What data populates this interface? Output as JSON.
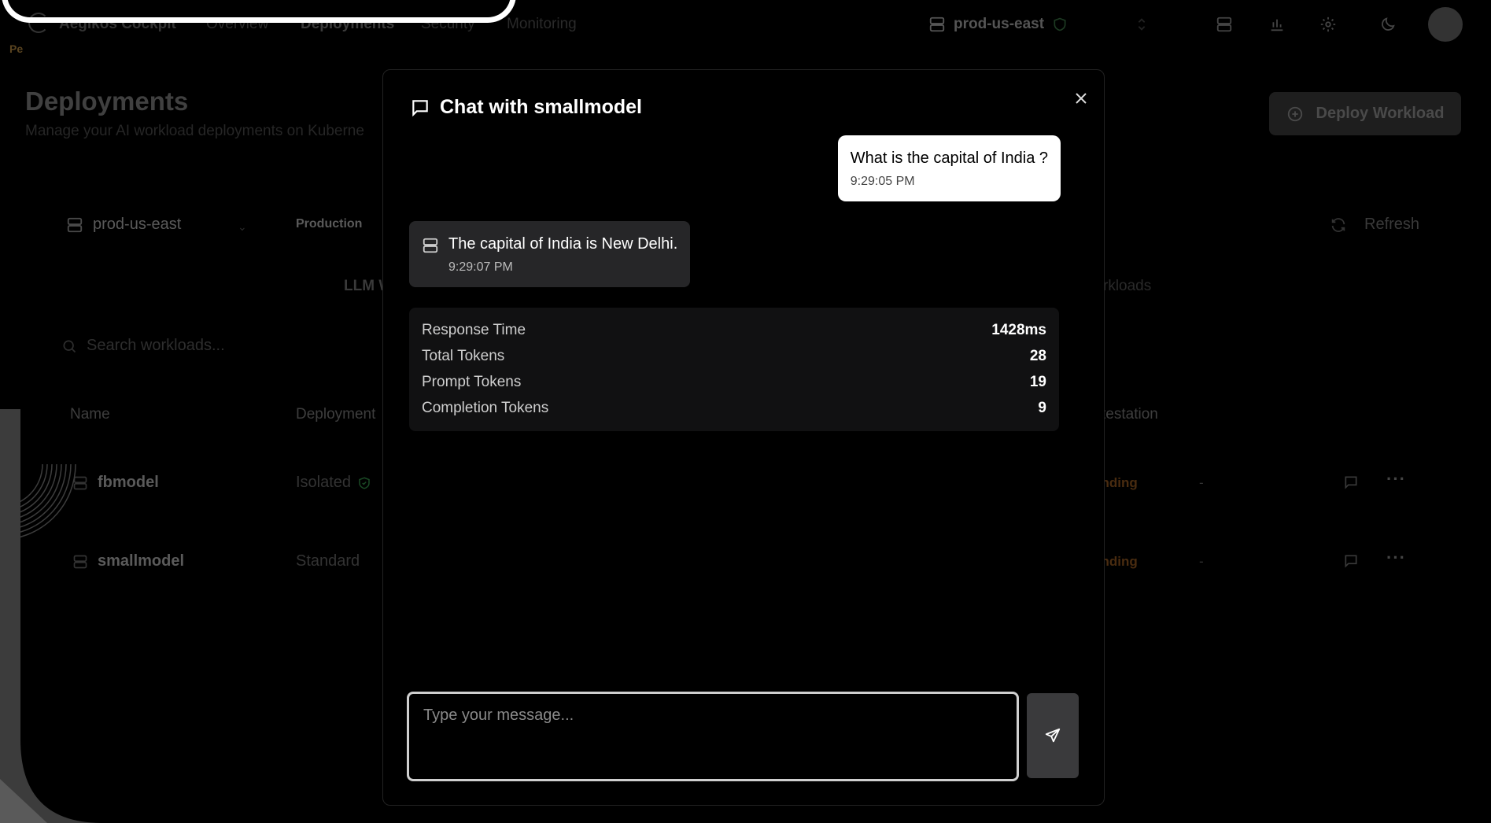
{
  "nav": {
    "brand": "Aegikos Cockpit",
    "brand_sub": "Pe",
    "links": [
      "Overview",
      "Deployments",
      "Security",
      "Monitoring"
    ],
    "cluster": "prod-us-east"
  },
  "page": {
    "title": "Deployments",
    "subtitle": "Manage your AI workload deployments on Kuberne",
    "deploy_label": "Deploy Workload"
  },
  "filters": {
    "cluster": "prod-us-east",
    "env": "Production",
    "refresh_label": "Refresh",
    "tab_llm": "LLM W",
    "tab_workloads": "rkloads",
    "search_placeholder": "Search workloads..."
  },
  "table": {
    "columns": {
      "name": "Name",
      "deployment": "Deployment",
      "attestation": "testation"
    },
    "rows": [
      {
        "name": "fbmodel",
        "deployment": "Isolated",
        "status": "ending",
        "dash": "-"
      },
      {
        "name": "smallmodel",
        "deployment": "Standard",
        "status": "ending",
        "dash": "-"
      }
    ]
  },
  "chat": {
    "title": "Chat with smallmodel",
    "messages": [
      {
        "role": "user",
        "text": "What is the capital of India ?",
        "time": "9:29:05 PM"
      },
      {
        "role": "assistant",
        "text": "The capital of India is New Delhi.",
        "time": "9:29:07 PM"
      }
    ],
    "metrics": [
      {
        "label": "Response Time",
        "value": "1428ms"
      },
      {
        "label": "Total Tokens",
        "value": "28"
      },
      {
        "label": "Prompt Tokens",
        "value": "19"
      },
      {
        "label": "Completion Tokens",
        "value": "9"
      }
    ],
    "input_placeholder": "Type your message..."
  },
  "colors": {
    "accent": "#ffffff",
    "pending": "#f97316",
    "shield": "#22c55e"
  }
}
